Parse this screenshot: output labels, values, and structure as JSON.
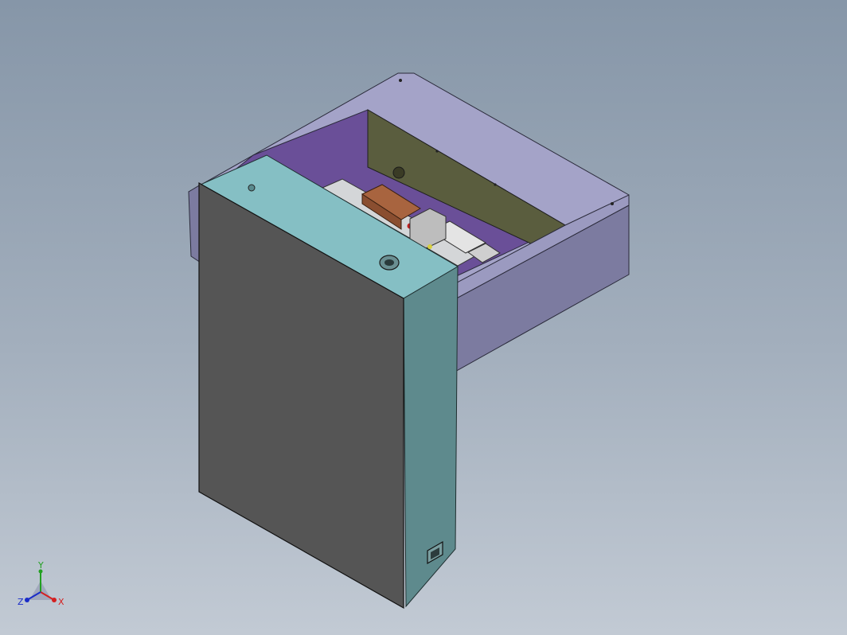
{
  "viewport": {
    "background_top": "#8696a8",
    "background_bottom": "#c2cad4"
  },
  "model": {
    "colors": {
      "cabinet_front": "#555555",
      "cabinet_top": "#85bfc4",
      "cabinet_side": "#5e8a8d",
      "frame_top": "#a4a3c8",
      "frame_side": "#7c7ba0",
      "frame_inner": "#6a4f98",
      "back_panel": "#5a5d3e",
      "copper_block": "#a8643f"
    }
  },
  "triad": {
    "x_label": "X",
    "y_label": "Y",
    "z_label": "Z",
    "x_color": "#d42020",
    "y_color": "#22a020",
    "z_color": "#1a2cc8"
  }
}
